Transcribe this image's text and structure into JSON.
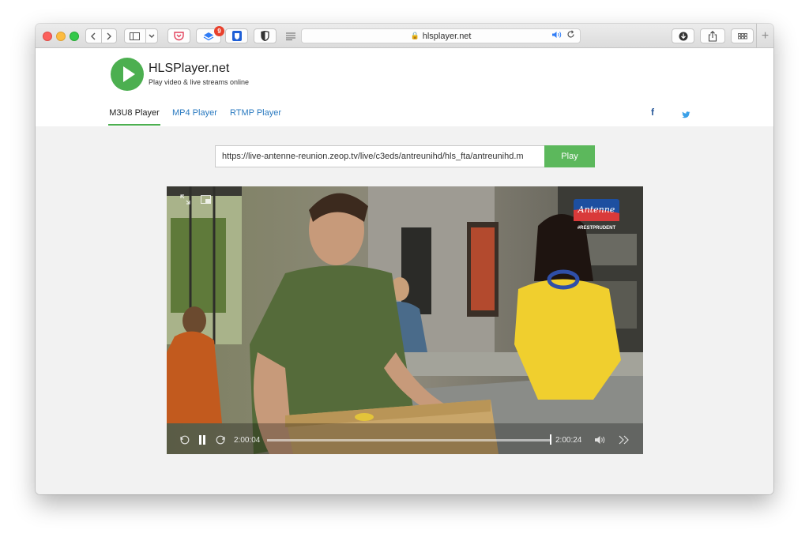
{
  "browser": {
    "url": "hlsplayer.net",
    "extension_badge_count": "9",
    "icons": {
      "back": "chevron-left-icon",
      "forward": "chevron-right-icon",
      "sidebar": "sidebar-icon",
      "reload": "reload-icon",
      "audio": "speaker-icon",
      "download": "download-icon",
      "share": "share-icon",
      "tabs": "tab-overview-icon",
      "new_tab": "plus-icon"
    }
  },
  "site": {
    "brand": "HLSPlayer.net",
    "tagline": "Play video & live streams online",
    "accent_color": "#4caf50",
    "link_color": "#2a7ac0"
  },
  "nav": {
    "tabs": [
      {
        "label": "M3U8 Player",
        "active": true
      },
      {
        "label": "MP4 Player",
        "active": false
      },
      {
        "label": "RTMP Player",
        "active": false
      }
    ],
    "social": {
      "facebook": "f",
      "twitter": "twitter-icon"
    }
  },
  "player_form": {
    "url_value": "https://live-antenne-reunion.zeop.tv/live/c3eds/antreunihd/hls_fta/antreunihd.m",
    "play_label": "Play"
  },
  "video": {
    "channel_logo": "Antenne",
    "channel_hashtag": "#RESTPRUDENT",
    "current_time": "2:00:04",
    "end_time": "2:00:24",
    "progress_fraction": 0.99
  }
}
